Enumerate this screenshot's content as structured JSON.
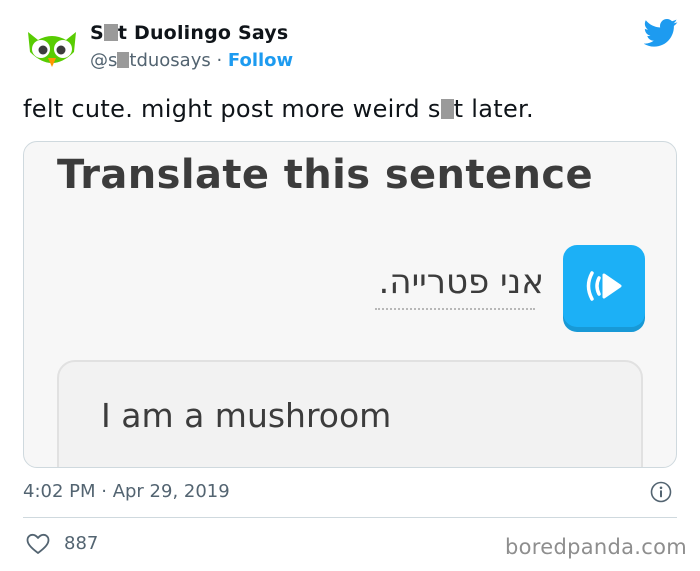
{
  "header": {
    "name_start": "S",
    "name_end": "t Duolingo Says",
    "handle_start": "@s",
    "handle_end": "tduosays",
    "separator": " · ",
    "follow_label": "Follow"
  },
  "tweet": {
    "text_start": "felt cute. might post more weird s",
    "text_end": "t later."
  },
  "media": {
    "title": "Translate this sentence",
    "hebrew_sentence": "אני פטרייה.",
    "answer_text": "I am a mushroom"
  },
  "footer": {
    "timestamp": "4:02 PM · Apr 29, 2019",
    "likes": "887"
  },
  "watermark": "boredpanda.com",
  "icons": {
    "avatar": "duolingo-owl-icon",
    "brand": "twitter-bird-icon",
    "info": "info-icon",
    "like": "heart-icon",
    "audio": "speaker-icon"
  },
  "colors": {
    "accent": "#1d9bf0",
    "duolingo_green": "#58cc02",
    "duolingo_blue": "#1cb0f6",
    "redaction": "#9a9a9a"
  }
}
